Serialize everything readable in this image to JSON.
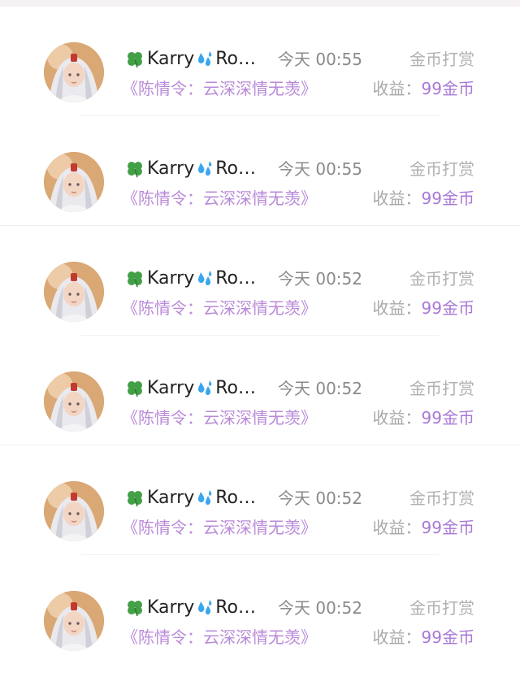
{
  "items": [
    {
      "name_prefix": "Karry",
      "name_suffix": "Ro…",
      "time": "今天 00:55",
      "action_label": "金币打赏",
      "title": "《陈情令：云深深情无羡》",
      "income_label": "收益：",
      "income_value": "99金币"
    },
    {
      "name_prefix": "Karry",
      "name_suffix": "Ro…",
      "time": "今天 00:55",
      "action_label": "金币打赏",
      "title": "《陈情令：云深深情无羡》",
      "income_label": "收益：",
      "income_value": "99金币"
    },
    {
      "name_prefix": "Karry",
      "name_suffix": "Ro…",
      "time": "今天 00:52",
      "action_label": "金币打赏",
      "title": "《陈情令：云深深情无羡》",
      "income_label": "收益：",
      "income_value": "99金币"
    },
    {
      "name_prefix": "Karry",
      "name_suffix": "Ro…",
      "time": "今天 00:52",
      "action_label": "金币打赏",
      "title": "《陈情令：云深深情无羡》",
      "income_label": "收益：",
      "income_value": "99金币"
    },
    {
      "name_prefix": "Karry",
      "name_suffix": "Ro…",
      "time": "今天 00:52",
      "action_label": "金币打赏",
      "title": "《陈情令：云深深情无羡》",
      "income_label": "收益：",
      "income_value": "99金币"
    },
    {
      "name_prefix": "Karry",
      "name_suffix": "Ro…",
      "time": "今天 00:52",
      "action_label": "金币打赏",
      "title": "《陈情令：云深深情无羡》",
      "income_label": "收益：",
      "income_value": "99金币"
    }
  ],
  "icons": {
    "name_leading": "four-leaf-clover-icon",
    "name_middle": "sweat-droplets-icon"
  },
  "colors": {
    "title": "#b98ad8",
    "income_value": "#a978d6",
    "name": "#222222",
    "time": "#8a8a8a",
    "muted": "#b0b0b0"
  }
}
